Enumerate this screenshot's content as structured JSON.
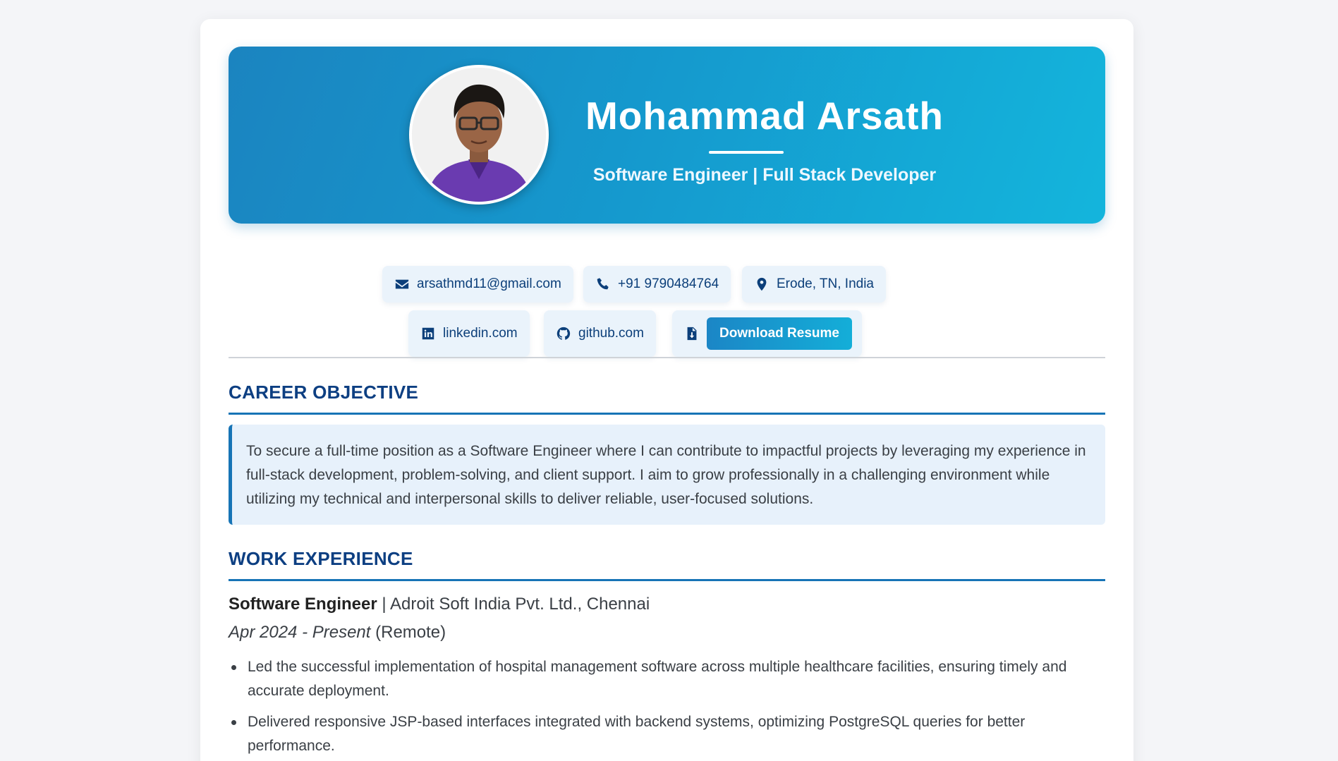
{
  "profile": {
    "name": "Mohammad Arsath",
    "role": "Software Engineer | Full Stack Developer"
  },
  "contacts": {
    "email": "arsathmd11@gmail.com",
    "phone": "+91 9790484764",
    "location": "Erode, TN, India",
    "linkedin": "linkedin.com",
    "github": "github.com",
    "download_label": "Download Resume"
  },
  "icons": {
    "email": "envelope-icon",
    "phone": "phone-icon",
    "location": "map-pin-icon",
    "linkedin": "linkedin-icon",
    "github": "github-icon",
    "resume": "file-download-icon"
  },
  "colors": {
    "hero_gradient_start": "#1b84c0",
    "hero_gradient_end": "#14b5dc",
    "heading": "#0d3f82",
    "accent": "#1774b6",
    "chip_bg": "#eaf3fb",
    "objective_bg": "#e7f1fb"
  },
  "sections": {
    "objective": {
      "title": "CAREER OBJECTIVE",
      "text": "To secure a full-time position as a Software Engineer where I can contribute to impactful projects by leveraging my experience in full-stack development, problem-solving, and client support. I aim to grow professionally in a challenging environment while utilizing my technical and interpersonal skills to deliver reliable, user-focused solutions."
    },
    "experience": {
      "title": "WORK EXPERIENCE",
      "jobs": [
        {
          "title": "Software Engineer",
          "separator": " | ",
          "company": "Adroit Soft India Pvt. Ltd., Chennai",
          "dates": "Apr 2024 - Present",
          "mode": " (Remote)",
          "bullets": [
            "Led the successful implementation of hospital management software across multiple healthcare facilities, ensuring timely and accurate deployment.",
            "Delivered responsive JSP-based interfaces integrated with backend systems, optimizing PostgreSQL queries for better performance."
          ]
        }
      ]
    }
  }
}
